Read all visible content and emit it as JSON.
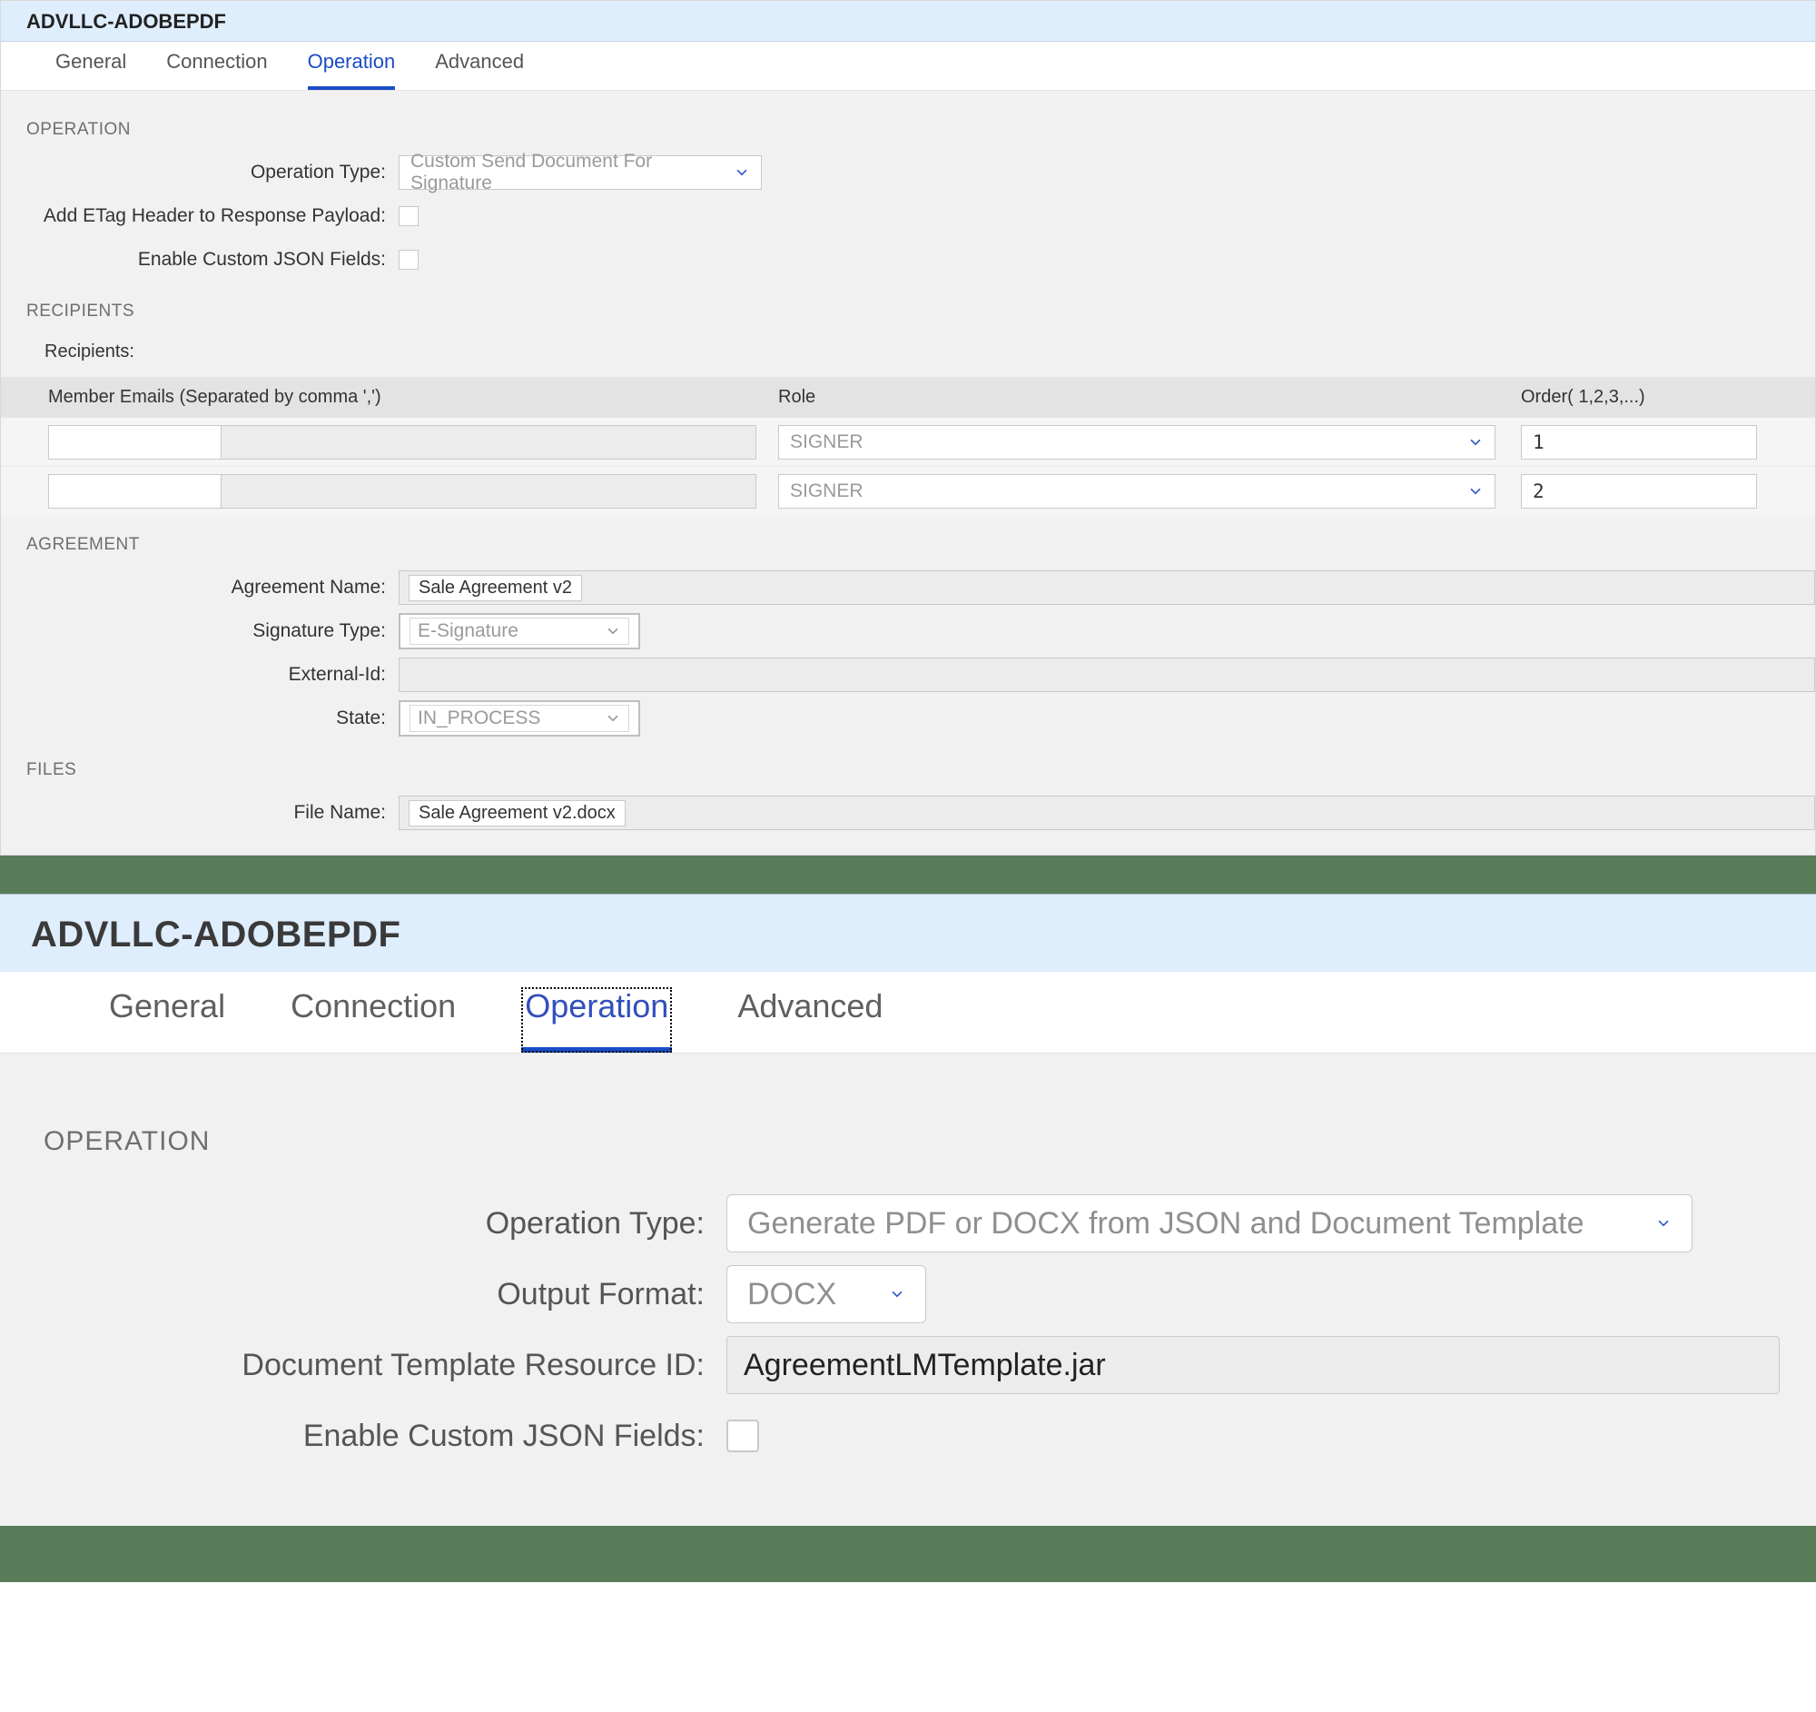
{
  "panel1": {
    "title": "ADVLLC-ADOBEPDF",
    "tabs": [
      "General",
      "Connection",
      "Operation",
      "Advanced"
    ],
    "activeTab": "Operation",
    "section_operation": "OPERATION",
    "operation_type_label": "Operation Type:",
    "operation_type_value": "Custom Send Document For Signature",
    "etag_label": "Add ETag Header to Response Payload:",
    "enable_json_label": "Enable Custom JSON Fields:",
    "section_recipients": "RECIPIENTS",
    "recipients_sub": "Recipients:",
    "col_emails": "Member Emails (Separated by comma ',')",
    "col_role": "Role",
    "col_order": "Order( 1,2,3,...)",
    "rows": [
      {
        "role": "SIGNER",
        "order": "1"
      },
      {
        "role": "SIGNER",
        "order": "2"
      }
    ],
    "section_agreement": "AGREEMENT",
    "agreement_name_label": "Agreement Name:",
    "agreement_name_value": "Sale Agreement v2",
    "signature_type_label": "Signature Type:",
    "signature_type_value": "E-Signature",
    "external_id_label": "External-Id:",
    "state_label": "State:",
    "state_value": "IN_PROCESS",
    "section_files": "FILES",
    "file_name_label": "File Name:",
    "file_name_value": "Sale Agreement v2.docx"
  },
  "panel2": {
    "title": "ADVLLC-ADOBEPDF",
    "tabs": [
      "General",
      "Connection",
      "Operation",
      "Advanced"
    ],
    "activeTab": "Operation",
    "section_operation": "OPERATION",
    "operation_type_label": "Operation Type:",
    "operation_type_value": "Generate PDF or DOCX from JSON and Document Template",
    "output_format_label": "Output Format:",
    "output_format_value": "DOCX",
    "template_id_label": "Document Template Resource ID:",
    "template_id_value": "AgreementLMTemplate.jar",
    "enable_json_label": "Enable Custom JSON Fields:"
  }
}
